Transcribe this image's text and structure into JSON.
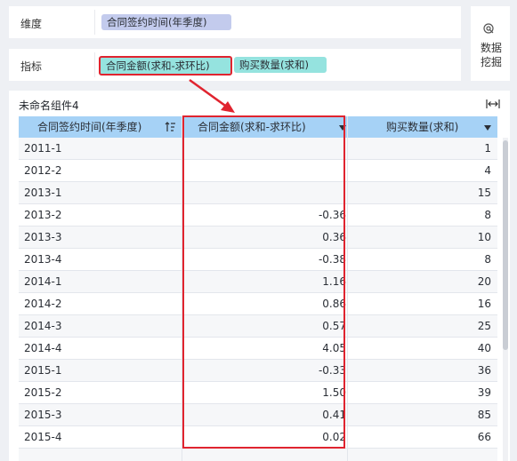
{
  "dimension_row": {
    "label": "维度",
    "field": "合同签约时间(年季度)"
  },
  "indicator_row": {
    "label": "指标",
    "fields": [
      "合同金额(求和-求环比)",
      "购买数量(求和)"
    ]
  },
  "data_mining": {
    "label": "数据\n挖掘",
    "icon": "data-mining-icon"
  },
  "component": {
    "title": "未命名组件4",
    "expand_icon": "expand-width-icon"
  },
  "table": {
    "columns": [
      "合同签约时间(年季度)",
      "合同金额(求和-求环比)",
      "购买数量(求和)"
    ],
    "rows": [
      [
        "2011-1",
        "",
        "1"
      ],
      [
        "2012-2",
        "",
        "4"
      ],
      [
        "2013-1",
        "",
        "15"
      ],
      [
        "2013-2",
        "-0.36",
        "8"
      ],
      [
        "2013-3",
        "0.36",
        "10"
      ],
      [
        "2013-4",
        "-0.38",
        "8"
      ],
      [
        "2014-1",
        "1.16",
        "20"
      ],
      [
        "2014-2",
        "0.86",
        "16"
      ],
      [
        "2014-3",
        "0.57",
        "25"
      ],
      [
        "2014-4",
        "4.05",
        "40"
      ],
      [
        "2015-1",
        "-0.33",
        "36"
      ],
      [
        "2015-2",
        "1.50",
        "39"
      ],
      [
        "2015-3",
        "0.41",
        "85"
      ],
      [
        "2015-4",
        "0.02",
        "66"
      ],
      [
        "",
        "",
        ""
      ]
    ]
  },
  "colors": {
    "highlight": "#e0242f",
    "header": "#a6d2f6",
    "dimension_pill": "#c3cbed",
    "indicator_pill": "#95e3df"
  }
}
